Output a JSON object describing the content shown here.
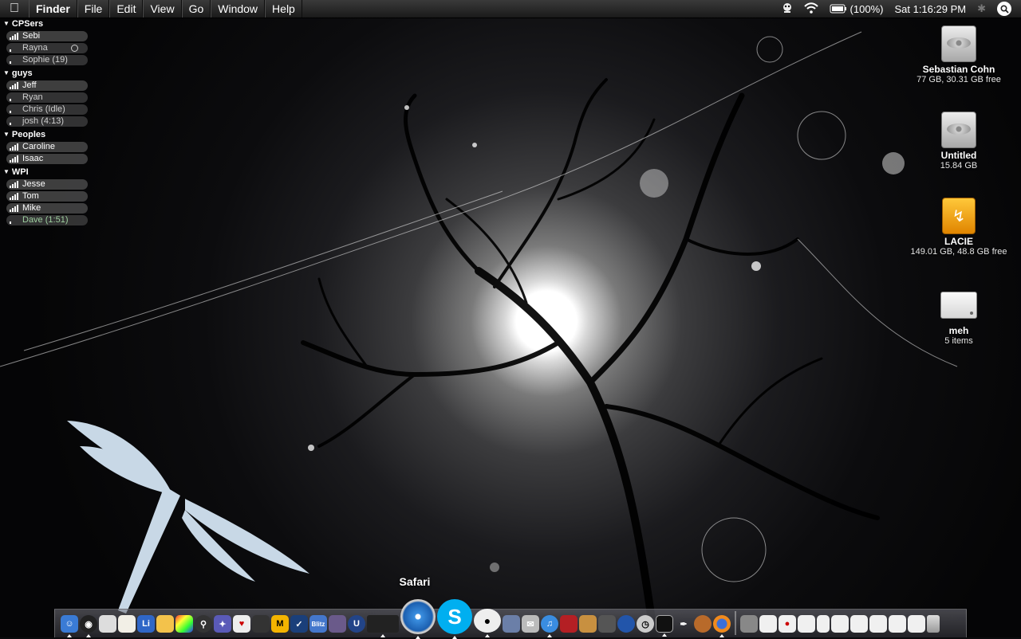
{
  "menubar": {
    "apple_icon": "apple-logo-icon",
    "app_name": "Finder",
    "items": [
      "File",
      "Edit",
      "View",
      "Go",
      "Window",
      "Help"
    ],
    "battery": "(100%)",
    "clock": "Sat 1:16:29 PM",
    "status_icons": [
      "adium-duck-icon",
      "wifi-icon",
      "battery-icon",
      "bluetooth-icon",
      "spotlight-icon"
    ]
  },
  "buddy_list": {
    "groups": [
      {
        "name": "CPSers",
        "buddies": [
          {
            "name": "Sebi",
            "status": ""
          },
          {
            "name": "Rayna",
            "status": ""
          },
          {
            "name": "Sophie",
            "status": "(19)"
          }
        ]
      },
      {
        "name": "guys",
        "buddies": [
          {
            "name": "Jeff",
            "status": ""
          },
          {
            "name": "Ryan",
            "status": ""
          },
          {
            "name": "Chris",
            "status": "(Idle)"
          },
          {
            "name": "josh",
            "status": "(4:13)"
          }
        ]
      },
      {
        "name": "Peoples",
        "buddies": [
          {
            "name": "Caroline",
            "status": ""
          },
          {
            "name": "Isaac",
            "status": ""
          }
        ]
      },
      {
        "name": "WPI",
        "buddies": [
          {
            "name": "Jesse",
            "status": ""
          },
          {
            "name": "Tom",
            "status": ""
          },
          {
            "name": "Mike",
            "status": ""
          },
          {
            "name": "Dave",
            "status": "(1:51)"
          }
        ]
      }
    ]
  },
  "desktop_icons": [
    {
      "name": "Sebastian Cohn",
      "info": "77 GB, 30.31 GB free"
    },
    {
      "name": "Untitled",
      "info": "15.84 GB"
    },
    {
      "name": "LACIE",
      "info": "149.01 GB, 48.8 GB free"
    },
    {
      "name": "meh",
      "info": "5 items"
    }
  ],
  "dock": {
    "hover_label": "Safari",
    "apps": [
      "finder-icon",
      "dashboard-icon",
      "preview-icon",
      "textedit-icon",
      "vlc-icon",
      "pages-icon",
      "color-picker-icon",
      "magnifier-icon",
      "xcode-icon",
      "cards-icon",
      "lightspeed-icon",
      "m-app-icon",
      "checkmark-app-icon",
      "blitz-icon",
      "warcraft-icon",
      "unreal-icon",
      "console-icon",
      "safari-icon",
      "skype-icon",
      "adium-icon",
      "image-icon",
      "mail-icon",
      "itunes-icon",
      "photobooth-icon",
      "iphoto-icon",
      "terminal-icon",
      "network-icon",
      "clock-icon",
      "monitor-icon",
      "quill-icon",
      "acorn-icon",
      "firefox-icon"
    ],
    "docs": [
      "documents-stack-icon",
      "docs-stack-icon",
      "document-icon",
      "document-icon",
      "document-icon",
      "document-icon",
      "document-icon",
      "document-icon",
      "document-icon",
      "document-icon",
      "trash-icon"
    ]
  }
}
